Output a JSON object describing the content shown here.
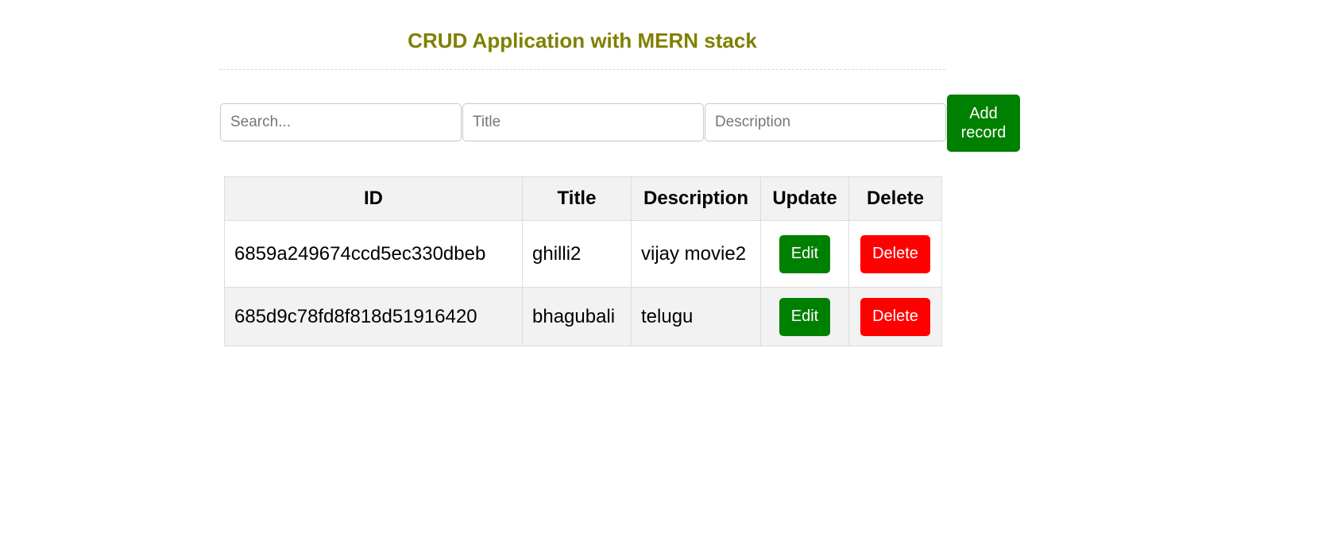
{
  "header": {
    "title": "CRUD Application with MERN stack"
  },
  "form": {
    "search_placeholder": "Search...",
    "title_placeholder": "Title",
    "description_placeholder": "Description",
    "add_label": "Add record"
  },
  "table": {
    "columns": [
      "ID",
      "Title",
      "Description",
      "Update",
      "Delete"
    ],
    "rows": [
      {
        "id": "6859a249674ccd5ec330dbeb",
        "title": "ghilli2",
        "description": "vijay movie2",
        "edit_label": "Edit",
        "delete_label": "Delete"
      },
      {
        "id": "685d9c78fd8f818d51916420",
        "title": "bhagubali",
        "description": "telugu",
        "edit_label": "Edit",
        "delete_label": "Delete"
      }
    ]
  },
  "colors": {
    "title": "#808000",
    "edit_button": "#008000",
    "add_button": "#008000",
    "delete_button": "#ff0000",
    "header_row": "#f2f2f2"
  }
}
